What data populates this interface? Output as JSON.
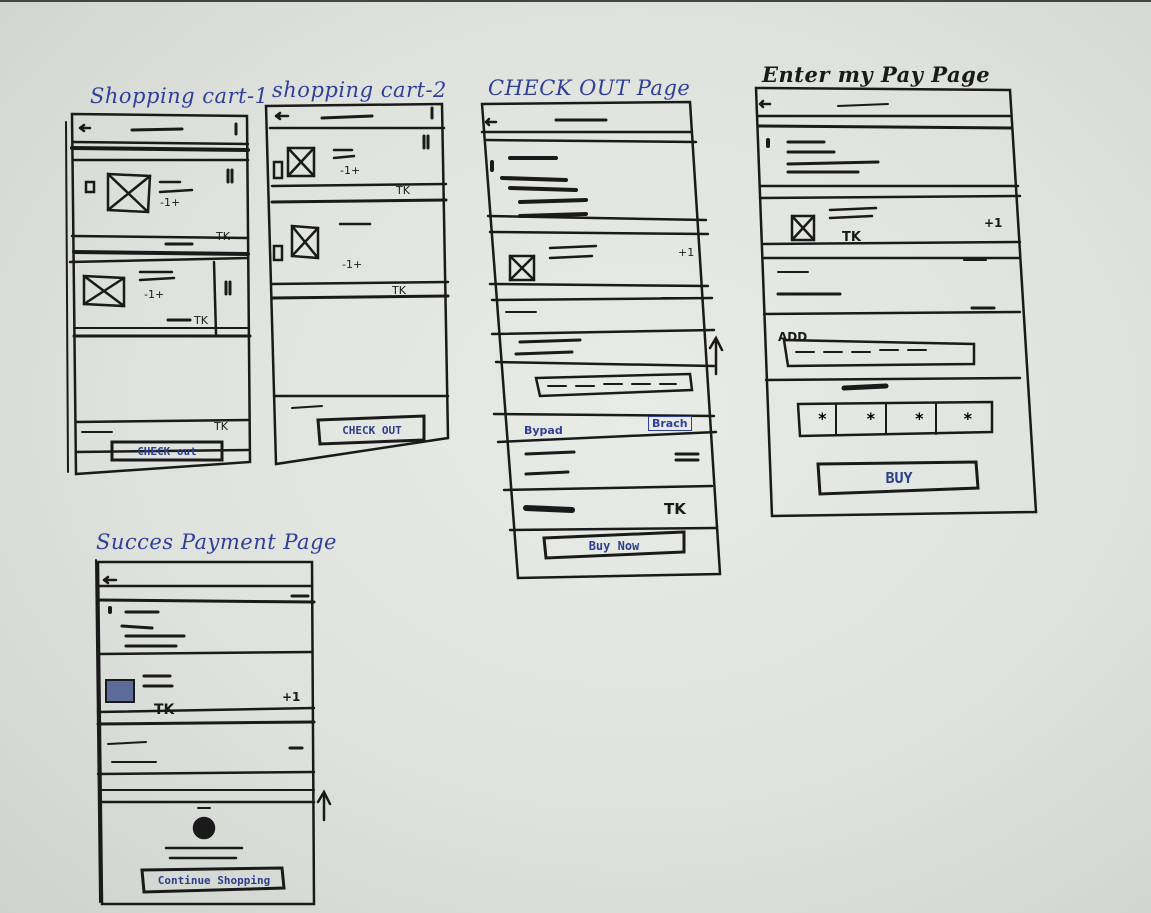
{
  "titles": {
    "cart1": "Shopping cart-1",
    "cart2": "shopping cart-2",
    "checkout": "CHECK OUT Page",
    "mypay": "Enter my Pay Page",
    "success": "Succes Payment Page"
  },
  "cart1": {
    "qty_a": "-1+",
    "qty_b": "-1+",
    "total_a": "TK",
    "total_b": "TK",
    "total_c": "TK",
    "button": "CHECK out"
  },
  "cart2": {
    "qty_a": "-1+",
    "qty_b": "-1+",
    "total_a": "TK",
    "total_b": "TK",
    "button": "CHECK OUT"
  },
  "checkout": {
    "qty": "+1",
    "link_left": "Bypad",
    "link_right": "Brach",
    "total": "TK",
    "button": "Buy Now"
  },
  "mypay": {
    "total": "TK",
    "qty": "+1",
    "add_label": "ADD",
    "pin_keys": [
      "*",
      "*",
      "*",
      "*"
    ],
    "button": "BUY"
  },
  "success": {
    "total": "TK",
    "qty": "+1",
    "button": "Continue Shopping"
  },
  "colors": {
    "ink": "#1a1a1a",
    "marker_blue": "#2f3f9a",
    "board": "#e3e6e1"
  }
}
